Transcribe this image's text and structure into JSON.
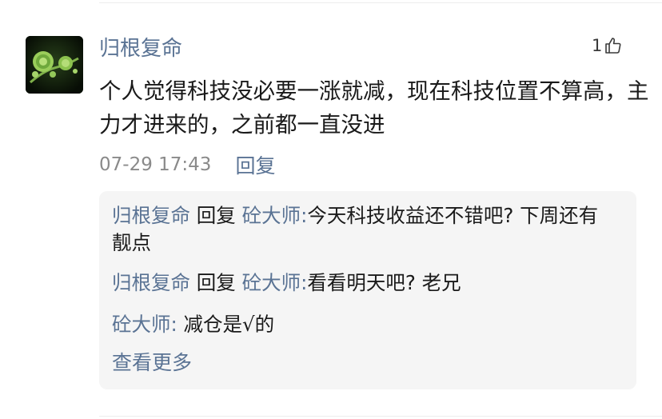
{
  "comment": {
    "username": "归根复命",
    "like_count": "1",
    "like_icon": "thumbs-up-icon",
    "content": "个人觉得科技没必要一涨就减，现在科技位置不算高，主力才进来的，之前都一直没进",
    "timestamp": "07-29 17:43",
    "reply_label": "回复"
  },
  "replies": [
    {
      "author": "归根复命",
      "verb": " 回复 ",
      "target": "砼大师:",
      "text": "今天科技收益还不错吧? 下周还有靓点"
    },
    {
      "author": "归根复命",
      "verb": " 回复 ",
      "target": "砼大师:",
      "text": "看看明天吧? 老兄"
    },
    {
      "author": "砼大师:",
      "text": " 减仓是√的"
    }
  ],
  "more_label": "查看更多",
  "colors": {
    "link_blue": "#5a7394",
    "reply_bg": "#f5f5f5",
    "time_gray": "#8a8a8a",
    "text": "#1a1a1a"
  }
}
